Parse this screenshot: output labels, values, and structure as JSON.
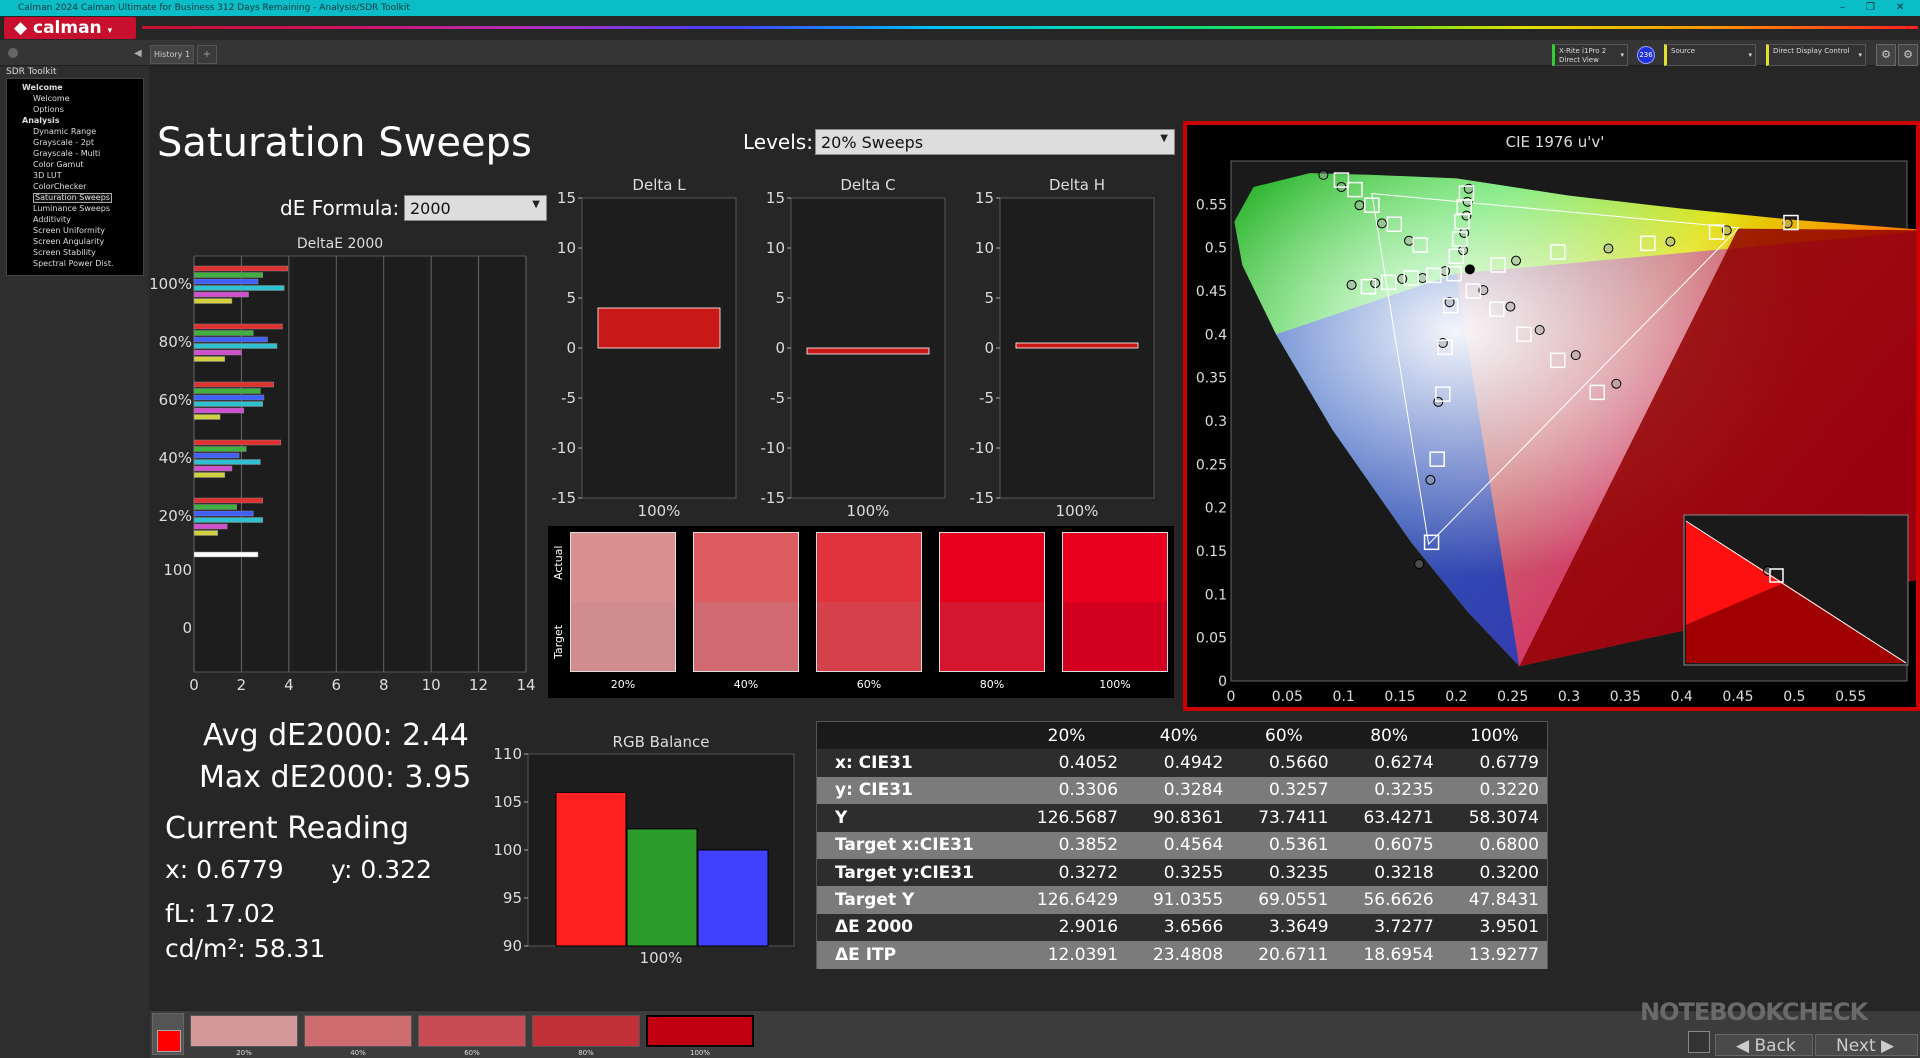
{
  "window": {
    "title": "Calman 2024 Calman Ultimate for Business 312 Days Remaining - Analysis/SDR Toolkit",
    "min": "–",
    "max": "❐",
    "close": "✕"
  },
  "app": {
    "logo": "calman",
    "tab": "History 1",
    "tab_add": "+"
  },
  "devices": {
    "meter": "X-Rite i1Pro 2",
    "meter_mode": "Direct View",
    "meter_badge": "236",
    "source": "Source",
    "display": "Direct Display Control"
  },
  "sidebar": {
    "header": "SDR Toolkit",
    "items": [
      {
        "label": "Welcome",
        "level": "group"
      },
      {
        "label": "Welcome",
        "level": "item"
      },
      {
        "label": "Options",
        "level": "item"
      },
      {
        "label": "Analysis",
        "level": "group"
      },
      {
        "label": "Dynamic Range",
        "level": "item"
      },
      {
        "label": "Grayscale - 2pt",
        "level": "item"
      },
      {
        "label": "Grayscale - Multi",
        "level": "item"
      },
      {
        "label": "Color Gamut",
        "level": "item"
      },
      {
        "label": "3D LUT",
        "level": "item"
      },
      {
        "label": "ColorChecker",
        "level": "item"
      },
      {
        "label": "Saturation Sweeps",
        "level": "item",
        "selected": true
      },
      {
        "label": "Luminance Sweeps",
        "level": "item"
      },
      {
        "label": "Additivity",
        "level": "item"
      },
      {
        "label": "Screen Uniformity",
        "level": "item"
      },
      {
        "label": "Screen Angularity",
        "level": "item"
      },
      {
        "label": "Screen Stability",
        "level": "item"
      },
      {
        "label": "Spectral Power Dist.",
        "level": "item"
      }
    ]
  },
  "page": {
    "title": "Saturation Sweeps",
    "levels_label": "Levels:",
    "levels_value": "20% Sweeps",
    "formula_label": "dE Formula:",
    "formula_value": "2000"
  },
  "stats": {
    "avg": "Avg dE2000: 2.44",
    "max": "Max dE2000: 3.95",
    "current_title": "Current Reading",
    "x": "x: 0.6779",
    "y": "y: 0.322",
    "fl": "fL: 17.02",
    "cdm": "cd/m²: 58.31"
  },
  "colors": {
    "red": "#ff2020",
    "green": "#2a9a2a",
    "blue": "#4040ff",
    "accent": "#c8102e",
    "frame": "#cc0000"
  },
  "chart_data": [
    {
      "type": "bar",
      "title": "DeltaE 2000",
      "orientation": "horizontal",
      "xlim": [
        0,
        14
      ],
      "xticks": [
        "0",
        "2",
        "4",
        "6",
        "8",
        "10",
        "12",
        "14"
      ],
      "categories": [
        "100%",
        "80%",
        "60%",
        "40%",
        "20%",
        "100",
        "0"
      ],
      "series_colors": [
        "#e03030",
        "#40b040",
        "#4060ff",
        "#30c0d0",
        "#d050d0",
        "#d0d040",
        "#ffffff"
      ],
      "groups": [
        {
          "label": "100%",
          "values": [
            3.95,
            2.9,
            2.7,
            3.8,
            2.3,
            1.6
          ]
        },
        {
          "label": "80%",
          "values": [
            3.73,
            2.5,
            3.1,
            3.5,
            2.0,
            1.3
          ]
        },
        {
          "label": "60%",
          "values": [
            3.36,
            2.8,
            2.95,
            2.9,
            2.1,
            1.1
          ]
        },
        {
          "label": "40%",
          "values": [
            3.66,
            2.2,
            1.9,
            2.8,
            1.6,
            1.3
          ]
        },
        {
          "label": "20%",
          "values": [
            2.9,
            1.8,
            2.5,
            2.9,
            1.4,
            1.0
          ]
        },
        {
          "label": "100",
          "values": [
            2.7
          ]
        },
        {
          "label": "0",
          "values": []
        }
      ]
    },
    {
      "type": "bar",
      "title": "Delta L",
      "ylim": [
        -15,
        15
      ],
      "yticks": [
        "15",
        "10",
        "5",
        "0",
        "-5",
        "-10",
        "-15"
      ],
      "categories": [
        "100%"
      ],
      "values": [
        4
      ]
    },
    {
      "type": "bar",
      "title": "Delta C",
      "ylim": [
        -15,
        15
      ],
      "yticks": [
        "15",
        "10",
        "5",
        "0",
        "-5",
        "-10",
        "-15"
      ],
      "categories": [
        "100%"
      ],
      "values": [
        -0.6
      ]
    },
    {
      "type": "bar",
      "title": "Delta H",
      "ylim": [
        -15,
        15
      ],
      "yticks": [
        "15",
        "10",
        "5",
        "0",
        "-5",
        "-10",
        "-15"
      ],
      "categories": [
        "100%"
      ],
      "values": [
        0.5
      ]
    },
    {
      "type": "bar",
      "title": "RGB Balance",
      "ylim": [
        90,
        110
      ],
      "yticks": [
        "110",
        "105",
        "100",
        "95",
        "90"
      ],
      "categories": [
        "100%"
      ],
      "series": [
        {
          "name": "R",
          "values": [
            106
          ]
        },
        {
          "name": "G",
          "values": [
            102.2
          ]
        },
        {
          "name": "B",
          "values": [
            100
          ]
        }
      ]
    },
    {
      "type": "scatter",
      "title": "CIE 1976 u'v'",
      "xlim": [
        0,
        0.6
      ],
      "ylim": [
        0,
        0.6
      ],
      "xticks": [
        "0",
        "0.05",
        "0.1",
        "0.15",
        "0.2",
        "0.25",
        "0.3",
        "0.35",
        "0.4",
        "0.45",
        "0.5",
        "0.55"
      ],
      "yticks": [
        "0",
        "0.05",
        "0.1",
        "0.15",
        "0.2",
        "0.25",
        "0.3",
        "0.35",
        "0.4",
        "0.45",
        "0.5",
        "0.55"
      ],
      "gamut": [
        [
          0.4507,
          0.5229
        ],
        [
          0.125,
          0.5625
        ],
        [
          0.1754,
          0.1579
        ]
      ],
      "targets": [
        [
          0.098,
          0.578
        ],
        [
          0.11,
          0.567
        ],
        [
          0.125,
          0.549
        ],
        [
          0.145,
          0.527
        ],
        [
          0.168,
          0.503
        ],
        [
          0.209,
          0.563
        ],
        [
          0.207,
          0.547
        ],
        [
          0.205,
          0.53
        ],
        [
          0.203,
          0.51
        ],
        [
          0.2,
          0.49
        ],
        [
          0.122,
          0.455
        ],
        [
          0.14,
          0.46
        ],
        [
          0.16,
          0.465
        ],
        [
          0.18,
          0.468
        ],
        [
          0.198,
          0.47
        ],
        [
          0.237,
          0.48
        ],
        [
          0.29,
          0.495
        ],
        [
          0.37,
          0.505
        ],
        [
          0.431,
          0.518
        ],
        [
          0.497,
          0.529
        ],
        [
          0.215,
          0.45
        ],
        [
          0.236,
          0.429
        ],
        [
          0.26,
          0.4
        ],
        [
          0.29,
          0.37
        ],
        [
          0.325,
          0.333
        ],
        [
          0.195,
          0.433
        ],
        [
          0.19,
          0.385
        ],
        [
          0.188,
          0.331
        ],
        [
          0.183,
          0.256
        ],
        [
          0.178,
          0.16
        ]
      ],
      "measured": [
        [
          0.082,
          0.584
        ],
        [
          0.098,
          0.57
        ],
        [
          0.114,
          0.549
        ],
        [
          0.134,
          0.528
        ],
        [
          0.158,
          0.508
        ],
        [
          0.211,
          0.568
        ],
        [
          0.21,
          0.553
        ],
        [
          0.209,
          0.537
        ],
        [
          0.207,
          0.517
        ],
        [
          0.206,
          0.497
        ],
        [
          0.107,
          0.457
        ],
        [
          0.128,
          0.459
        ],
        [
          0.152,
          0.464
        ],
        [
          0.17,
          0.465
        ],
        [
          0.19,
          0.473
        ],
        [
          0.253,
          0.485
        ],
        [
          0.335,
          0.499
        ],
        [
          0.39,
          0.507
        ],
        [
          0.44,
          0.52
        ],
        [
          0.494,
          0.528
        ],
        [
          0.224,
          0.451
        ],
        [
          0.248,
          0.432
        ],
        [
          0.274,
          0.405
        ],
        [
          0.306,
          0.376
        ],
        [
          0.342,
          0.343
        ],
        [
          0.194,
          0.437
        ],
        [
          0.188,
          0.39
        ],
        [
          0.184,
          0.322
        ],
        [
          0.177,
          0.232
        ],
        [
          0.167,
          0.135
        ]
      ],
      "current": [
        0.212,
        0.475
      ]
    },
    {
      "type": "table",
      "columns": [
        "",
        "20%",
        "40%",
        "60%",
        "80%",
        "100%"
      ],
      "rows": [
        {
          "label": "x: CIE31",
          "cells": [
            "0.4052",
            "0.4942",
            "0.5660",
            "0.6274",
            "0.6779"
          ]
        },
        {
          "label": "y: CIE31",
          "cells": [
            "0.3306",
            "0.3284",
            "0.3257",
            "0.3235",
            "0.3220"
          ]
        },
        {
          "label": "Y",
          "cells": [
            "126.5687",
            "90.8361",
            "73.7411",
            "63.4271",
            "58.3074"
          ]
        },
        {
          "label": "Target x:CIE31",
          "cells": [
            "0.3852",
            "0.4564",
            "0.5361",
            "0.6075",
            "0.6800"
          ]
        },
        {
          "label": "Target y:CIE31",
          "cells": [
            "0.3272",
            "0.3255",
            "0.3235",
            "0.3218",
            "0.3200"
          ]
        },
        {
          "label": "Target Y",
          "cells": [
            "126.6429",
            "91.0355",
            "69.0551",
            "56.6626",
            "47.8431"
          ]
        },
        {
          "label": "ΔE 2000",
          "cells": [
            "2.9016",
            "3.6566",
            "3.3649",
            "3.7277",
            "3.9501"
          ]
        },
        {
          "label": "ΔE ITP",
          "cells": [
            "12.0391",
            "23.4808",
            "20.6711",
            "18.6954",
            "13.9277"
          ]
        }
      ]
    }
  ],
  "swatches": {
    "actual_label": "Actual",
    "target_label": "Target",
    "items": [
      {
        "label": "20%",
        "actual": "#d99090",
        "target": "#d08c8e"
      },
      {
        "label": "40%",
        "actual": "#dc5c62",
        "target": "#d06a70"
      },
      {
        "label": "60%",
        "actual": "#e0323c",
        "target": "#d4414a"
      },
      {
        "label": "80%",
        "actual": "#e6001c",
        "target": "#d51630"
      },
      {
        "label": "100%",
        "actual": "#e8001e",
        "target": "#d40020"
      }
    ]
  },
  "bottom": {
    "items": [
      {
        "label": "20%",
        "color": "#d39898"
      },
      {
        "label": "40%",
        "color": "#cf6c70"
      },
      {
        "label": "60%",
        "color": "#c84c52"
      },
      {
        "label": "80%",
        "color": "#c23038"
      },
      {
        "label": "100%",
        "color": "#c00010"
      }
    ],
    "back": "Back",
    "next": "Next",
    "watermark": "NOTEBOOKCHECK"
  }
}
